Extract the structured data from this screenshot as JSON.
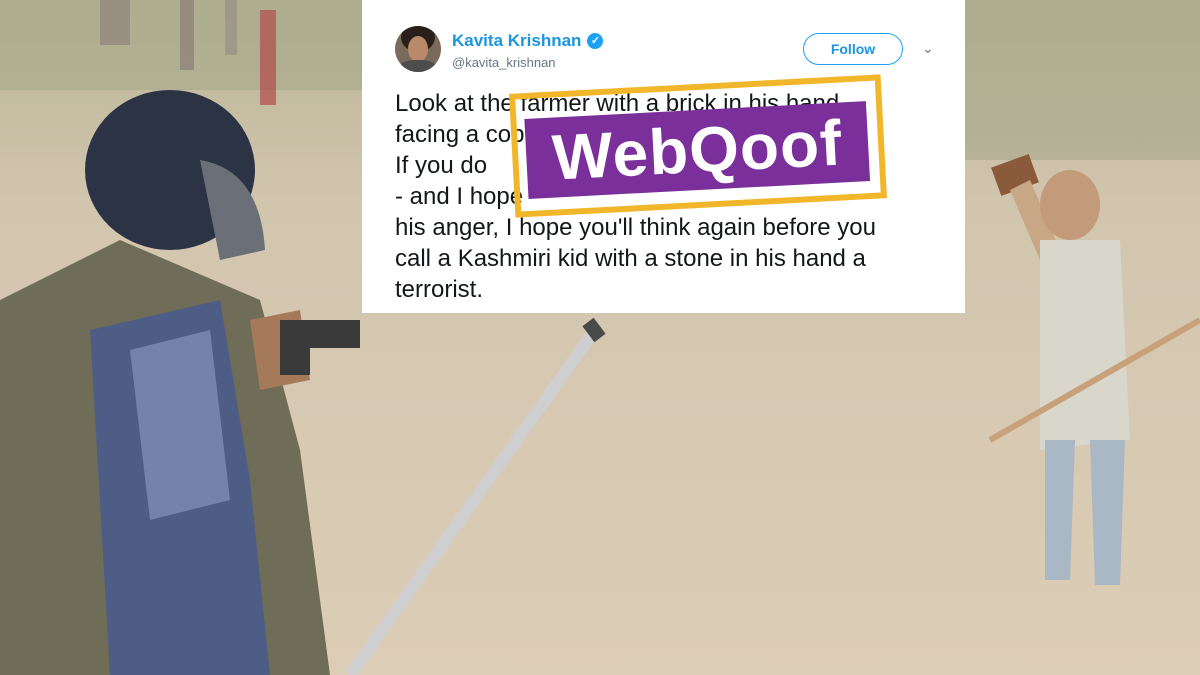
{
  "tweet": {
    "display_name": "Kavita Krishnan",
    "handle": "@kavita_krishnan",
    "follow_label": "Follow",
    "lines": [
      "Look at the farmer with a brick in his hand,",
      "facing a cop with",
      "If you do",
      "- and I hope",
      "his anger, I hope you'll think again before you",
      "call a Kashmiri kid with a stone in his hand a",
      "terrorist."
    ]
  },
  "stamp": {
    "text": "WebQoof"
  },
  "icons": {
    "verified": "verified-badge-icon",
    "caret": "chevron-down-icon"
  },
  "colors": {
    "link_blue": "#1b95e0",
    "stamp_purple": "#7b2f9b",
    "stamp_gold": "#f2b62b"
  }
}
